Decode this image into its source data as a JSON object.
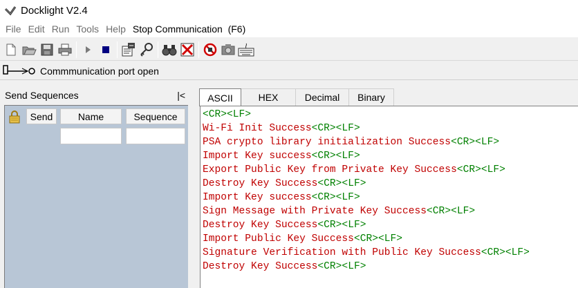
{
  "window": {
    "title": "Docklight V2.4"
  },
  "menu": [
    {
      "label": "File",
      "active": false
    },
    {
      "label": "Edit",
      "active": false
    },
    {
      "label": "Run",
      "active": false
    },
    {
      "label": "Tools",
      "active": false
    },
    {
      "label": "Help",
      "active": false
    },
    {
      "label": "Stop Communication  (F6)",
      "active": true
    }
  ],
  "toolbar": {
    "buttons": [
      {
        "name": "new-document-icon"
      },
      {
        "name": "open-folder-icon"
      },
      {
        "name": "save-icon"
      },
      {
        "name": "print-icon"
      },
      {
        "name": "separator"
      },
      {
        "name": "play-icon"
      },
      {
        "name": "stop-icon"
      },
      {
        "name": "separator"
      },
      {
        "name": "project-settings-icon"
      },
      {
        "name": "key-icon"
      },
      {
        "name": "separator"
      },
      {
        "name": "binoculars-icon"
      },
      {
        "name": "clear-window-icon"
      },
      {
        "name": "separator"
      },
      {
        "name": "disabled-record-icon"
      },
      {
        "name": "snapshot-icon"
      },
      {
        "name": "keyboard-icon"
      }
    ]
  },
  "status": {
    "text": "Commmunication port open"
  },
  "send_sequences": {
    "title": "Send Sequences",
    "collapse_label": "|<",
    "columns": {
      "send": "Send",
      "name": "Name",
      "sequence": "Sequence"
    }
  },
  "tabs": [
    {
      "label": "ASCII",
      "active": true
    },
    {
      "label": "HEX",
      "active": false
    },
    {
      "label": "Decimal",
      "active": false
    },
    {
      "label": "Binary",
      "active": false
    }
  ],
  "output": {
    "control_suffix": "<CR><LF>",
    "lines": [
      "",
      "Wi-Fi Init Success",
      "PSA crypto library initialization Success",
      "Import Key success",
      "Export Public Key from Private Key Success",
      "Destroy Key Success",
      "Import Key success",
      "Sign Message with Private Key Success",
      "Destroy Key Success",
      "Import Public Key Success",
      "Signature Verification with Public Key Success",
      "Destroy Key Success"
    ]
  },
  "colors": {
    "text": "#c00000",
    "control": "#008000",
    "panel": "#b8c6d6"
  }
}
